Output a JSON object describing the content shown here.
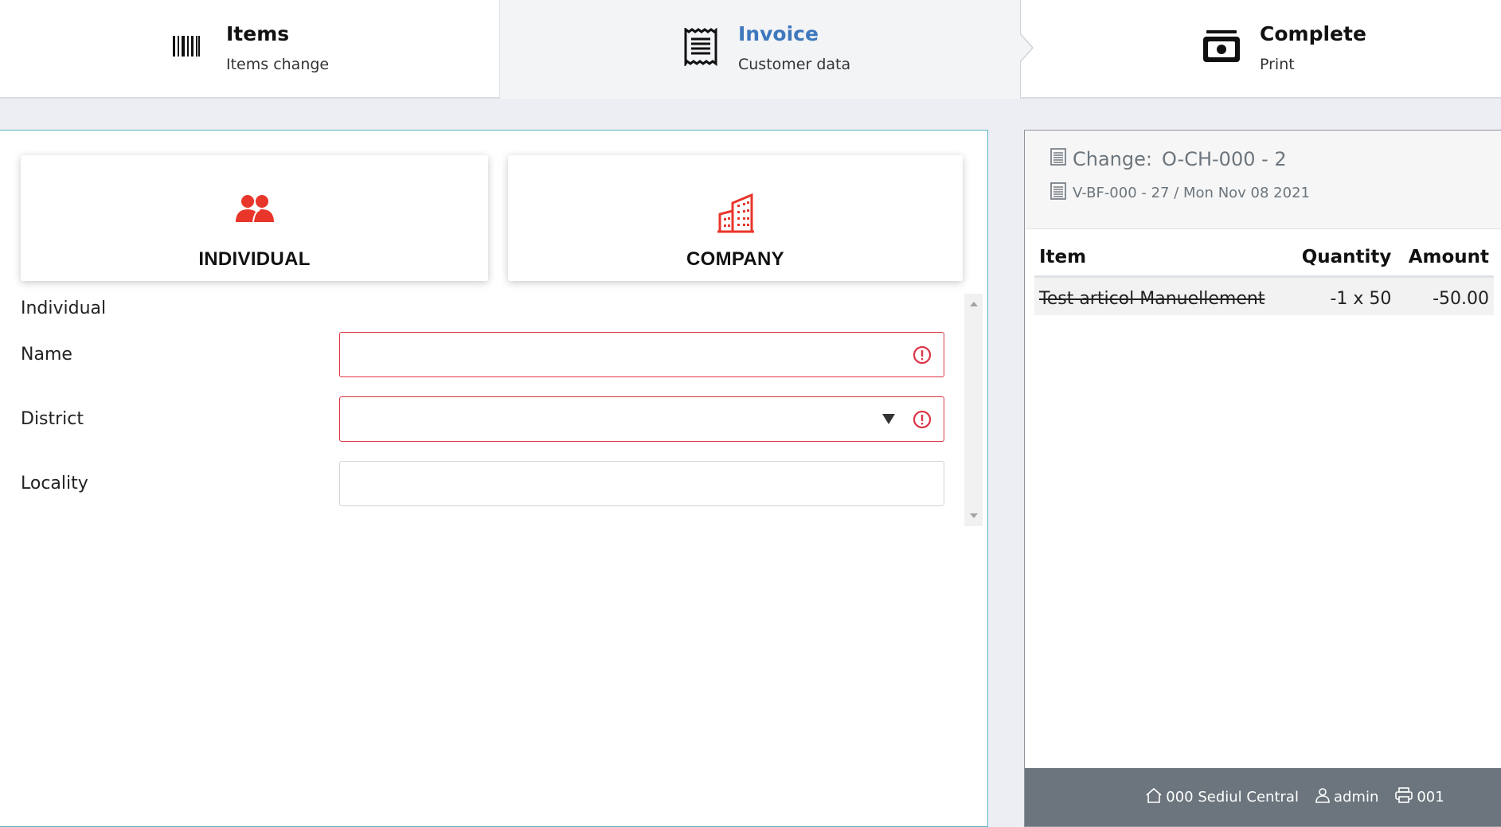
{
  "stepper": {
    "steps": [
      {
        "title": "Items",
        "subtitle": "Items change",
        "icon": "barcode-icon"
      },
      {
        "title": "Invoice",
        "subtitle": "Customer data",
        "icon": "receipt-icon"
      },
      {
        "title": "Complete",
        "subtitle": "Print",
        "icon": "cash-icon"
      }
    ],
    "active_color": "#3e78bd"
  },
  "customer_type": {
    "individual_label": "INDIVIDUAL",
    "company_label": "COMPANY",
    "icon_color": "#e8362b"
  },
  "form": {
    "section_title": "Individual",
    "fields": [
      {
        "label": "Name",
        "value": "",
        "invalid": true
      },
      {
        "label": "District",
        "value": "",
        "invalid": true
      },
      {
        "label": "Locality",
        "value": "",
        "invalid": false
      }
    ]
  },
  "receipt": {
    "change_label": "Change:",
    "change_number": "O-CH-000 - 2",
    "doc_line": "V-BF-000 - 27 / Mon Nov 08 2021",
    "columns": [
      "Item",
      "Quantity",
      "Amount"
    ],
    "rows": [
      {
        "item": "Test articol Manuellement",
        "quantity": "-1 x 50",
        "amount": "-50.00"
      }
    ]
  },
  "status_bar": {
    "location": "000 Sediul Central",
    "user": "admin",
    "printer": "001",
    "background": "#6c757d"
  }
}
